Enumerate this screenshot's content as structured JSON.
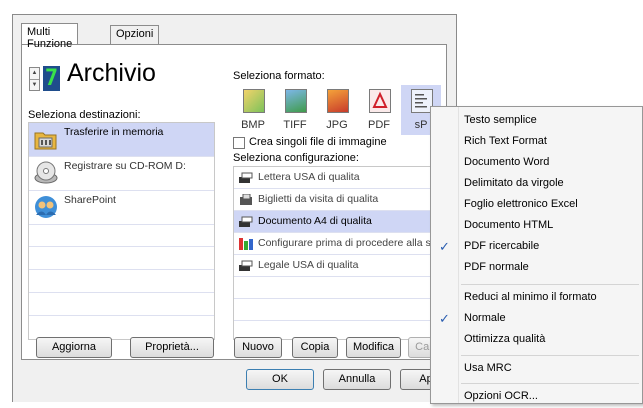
{
  "tabs": [
    "Multi Funzione",
    "Opzioni"
  ],
  "profile": {
    "number": "7",
    "name": "Archivio"
  },
  "destinations": {
    "label": "Seleziona destinazioni:",
    "items": [
      {
        "label": "Trasferire in memoria",
        "icon": "folder-memory-icon"
      },
      {
        "label": "Registrare su CD-ROM  D:",
        "icon": "cd-rom-icon"
      },
      {
        "label": "SharePoint",
        "icon": "sharepoint-icon"
      }
    ],
    "selected": "Trasferire in memoria"
  },
  "formats": {
    "label": "Seleziona formato:",
    "items": [
      "BMP",
      "TIFF",
      "JPG",
      "PDF",
      "sP"
    ],
    "selected": "sP"
  },
  "single_images_label": "Crea singoli file di immagine",
  "configurations": {
    "label": "Seleziona configurazione:",
    "items": [
      "Lettera USA di qualita",
      "Biglietti da visita di qualita",
      "Documento A4 di qualita",
      "Configurare prima di procedere alla sc.",
      "Legale USA di qualita"
    ],
    "selected": "Documento A4 di qualita"
  },
  "buttons": {
    "aggiorna": "Aggiorna",
    "proprieta": "Proprietà...",
    "nuovo": "Nuovo",
    "copia": "Copia",
    "modifica": "Modifica",
    "cancella": "Canc",
    "ok": "OK",
    "annulla": "Annulla",
    "applica": "Ap"
  },
  "menu": {
    "group1": [
      {
        "label": "Testo semplice",
        "checked": false
      },
      {
        "label": "Rich Text Format",
        "checked": false
      },
      {
        "label": "Documento Word",
        "checked": false
      },
      {
        "label": "Delimitato da virgole",
        "checked": false
      },
      {
        "label": "Foglio elettronico Excel",
        "checked": false
      },
      {
        "label": "Documento HTML",
        "checked": false
      },
      {
        "label": "PDF ricercabile",
        "checked": true
      },
      {
        "label": "PDF normale",
        "checked": false
      }
    ],
    "group2": [
      {
        "label": "Reduci al minimo il formato",
        "checked": false
      },
      {
        "label": "Normale",
        "checked": true
      },
      {
        "label": "Ottimizza qualità",
        "checked": false
      }
    ],
    "group3": [
      {
        "label": "Usa MRC",
        "checked": false
      }
    ],
    "group4": [
      {
        "label": "Opzioni OCR...",
        "checked": false
      }
    ],
    "check_glyph": "✓"
  },
  "colors": {
    "selection": "#cfd6f5",
    "check": "#2a5db0",
    "profile_box": "#1f4d8c"
  }
}
